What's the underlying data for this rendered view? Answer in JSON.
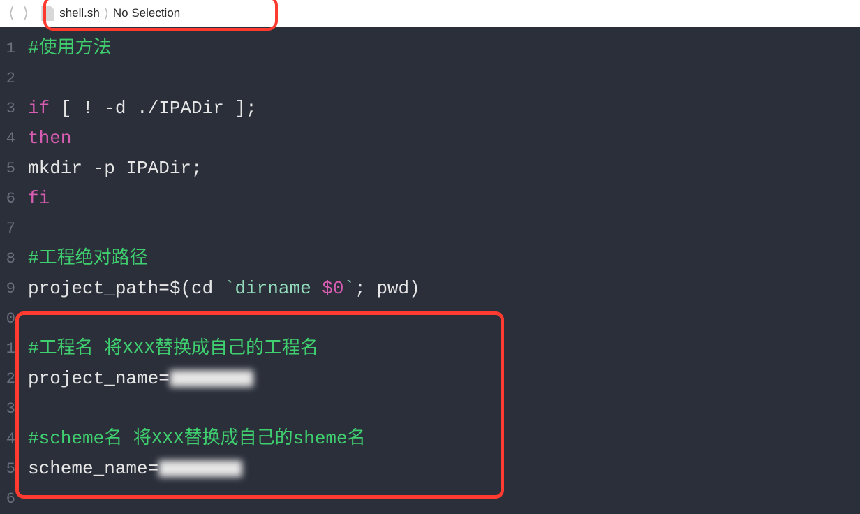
{
  "breadcrumb": {
    "filename": "shell.sh",
    "selection": "No Selection"
  },
  "gutter": {
    "lines": [
      "1",
      "2",
      "3",
      "4",
      "5",
      "6",
      "7",
      "8",
      "9",
      "0",
      "1",
      "2",
      "3",
      "4",
      "5",
      "6"
    ]
  },
  "code": {
    "l1": "#使用方法",
    "l3a": "if",
    "l3b": " [ ! -d ./IPADir ];",
    "l4": "then",
    "l5": "mkdir -p IPADir;",
    "l6": "fi",
    "l8": "#工程绝对路径",
    "l9a": "project_path=$(cd ",
    "l9b": "`dirname ",
    "l9c": "$0",
    "l9d": "`",
    "l9e": "; pwd)",
    "l11": "#工程名 将XXX替换成自己的工程名",
    "l12a": "project_name=",
    "l14": "#scheme名 将XXX替换成自己的sheme名",
    "l15a": "scheme_name="
  }
}
